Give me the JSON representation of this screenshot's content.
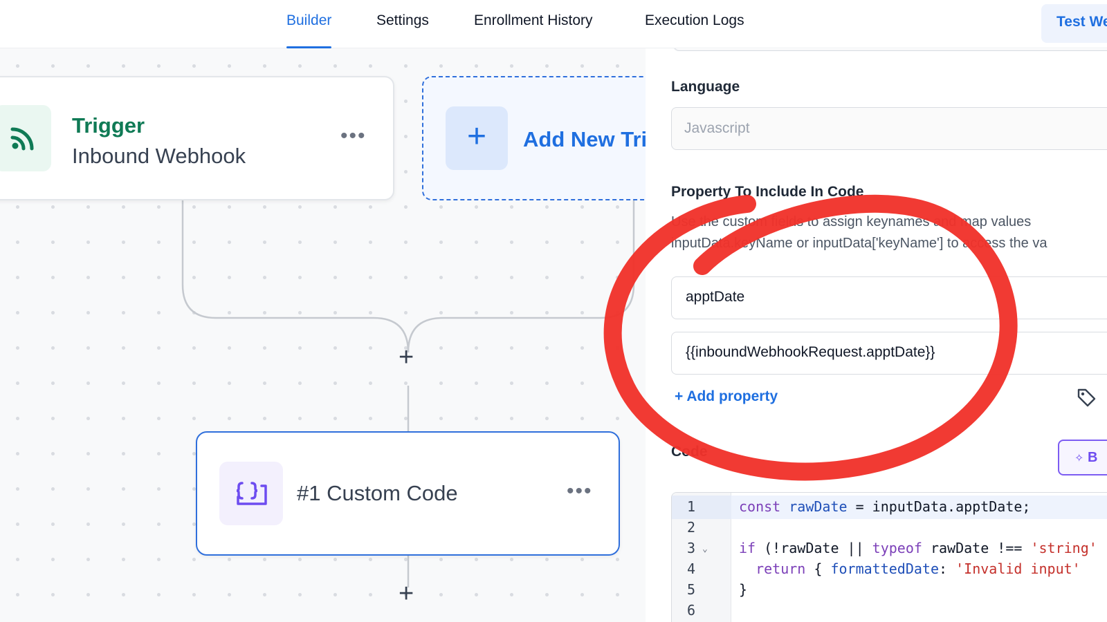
{
  "nav": {
    "tabs": [
      {
        "label": "Builder",
        "active": true
      },
      {
        "label": "Settings",
        "active": false
      },
      {
        "label": "Enrollment History",
        "active": false
      },
      {
        "label": "Execution Logs",
        "active": false
      }
    ],
    "test_button": "Test We"
  },
  "canvas": {
    "trigger_node": {
      "title": "Trigger",
      "subtitle": "Inbound Webhook",
      "menu": "•••",
      "icon": "rss-icon"
    },
    "add_trigger_node": {
      "plus": "+",
      "label": "Add New Tri"
    },
    "plus_1": "+",
    "plus_2": "+",
    "code_node": {
      "title": "#1 Custom Code",
      "menu": "•••",
      "icon": "code-braces-icon"
    }
  },
  "panel": {
    "language_label": "Language",
    "language_placeholder": "Javascript",
    "property_label": "Property To Include In Code",
    "help_line1": "Use the custom fields to assign keynames and map values",
    "help_line2": "inputData.keyName or inputData['keyName'] to access the va",
    "property_key_value": "apptDate",
    "property_value_value": "{{inboundWebhookRequest.apptDate}}",
    "add_property": "+ Add property",
    "code_label": "Code",
    "ai_button": "B",
    "code_lines": [
      "1",
      "2",
      "3",
      "4",
      "5",
      "6"
    ],
    "fold_marker": "⌄"
  },
  "colors": {
    "accent": "#1f6fe0",
    "trigger_green": "#0f7a55",
    "annotation_red": "#f0322b",
    "ai_purple": "#7c5cf2"
  }
}
